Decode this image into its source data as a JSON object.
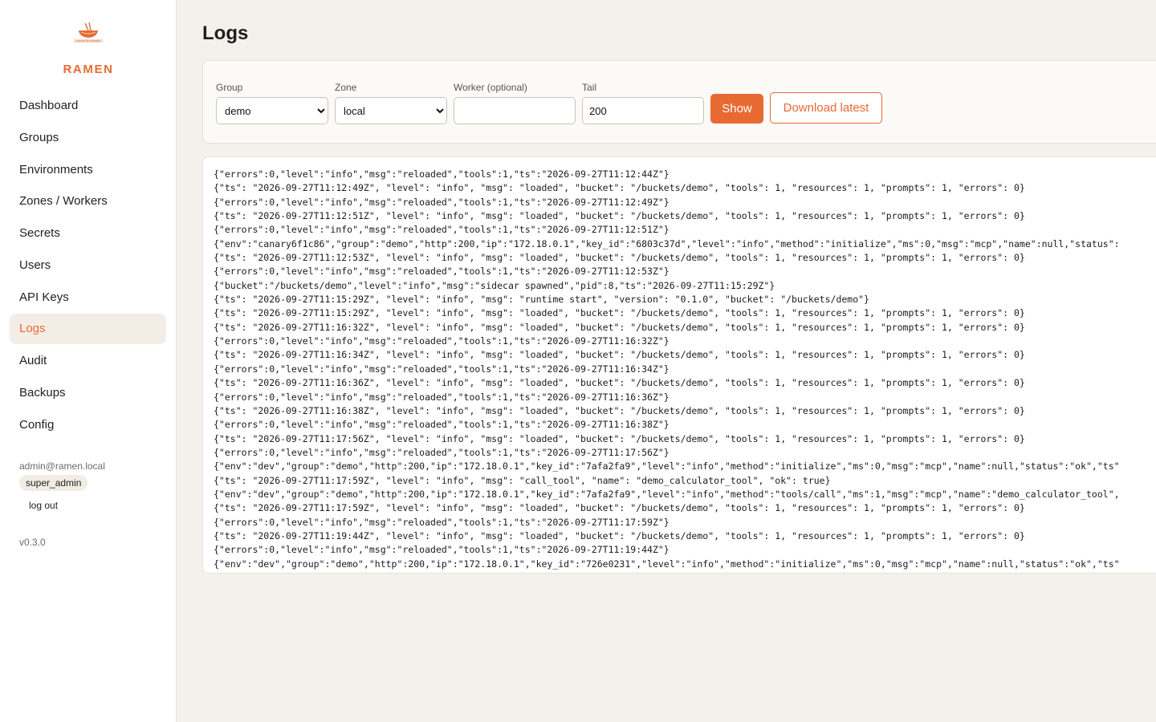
{
  "sidebar": {
    "brand": "RAMEN",
    "logo_text": "TASTE OF RAMEN",
    "items": [
      {
        "label": "Dashboard",
        "name": "sidebar-item-dashboard"
      },
      {
        "label": "Groups",
        "name": "sidebar-item-groups"
      },
      {
        "label": "Environments",
        "name": "sidebar-item-environments"
      },
      {
        "label": "Zones / Workers",
        "name": "sidebar-item-zones-workers"
      },
      {
        "label": "Secrets",
        "name": "sidebar-item-secrets"
      },
      {
        "label": "Users",
        "name": "sidebar-item-users"
      },
      {
        "label": "API Keys",
        "name": "sidebar-item-api-keys"
      },
      {
        "label": "Logs",
        "name": "sidebar-item-logs",
        "active": true
      },
      {
        "label": "Audit",
        "name": "sidebar-item-audit"
      },
      {
        "label": "Backups",
        "name": "sidebar-item-backups"
      },
      {
        "label": "Config",
        "name": "sidebar-item-config"
      }
    ],
    "user_email": "admin@ramen.local",
    "role": "super_admin",
    "logout_label": "log out",
    "version": "v0.3.0"
  },
  "page": {
    "title": "Logs"
  },
  "filters": {
    "group_label": "Group",
    "group_value": "demo",
    "zone_label": "Zone",
    "zone_value": "local",
    "worker_label": "Worker (optional)",
    "worker_value": "",
    "tail_label": "Tail",
    "tail_value": "200",
    "show_label": "Show",
    "download_label": "Download latest"
  },
  "colors": {
    "accent": "#e86a33",
    "active_bg": "#f3ede6",
    "page_bg": "#f4f1ec"
  },
  "logs": [
    "{\"errors\":0,\"level\":\"info\",\"msg\":\"reloaded\",\"tools\":1,\"ts\":\"2026-09-27T11:12:44Z\"}",
    "{\"ts\": \"2026-09-27T11:12:49Z\", \"level\": \"info\", \"msg\": \"loaded\", \"bucket\": \"/buckets/demo\", \"tools\": 1, \"resources\": 1, \"prompts\": 1, \"errors\": 0}",
    "{\"errors\":0,\"level\":\"info\",\"msg\":\"reloaded\",\"tools\":1,\"ts\":\"2026-09-27T11:12:49Z\"}",
    "{\"ts\": \"2026-09-27T11:12:51Z\", \"level\": \"info\", \"msg\": \"loaded\", \"bucket\": \"/buckets/demo\", \"tools\": 1, \"resources\": 1, \"prompts\": 1, \"errors\": 0}",
    "{\"errors\":0,\"level\":\"info\",\"msg\":\"reloaded\",\"tools\":1,\"ts\":\"2026-09-27T11:12:51Z\"}",
    "{\"env\":\"canary6f1c86\",\"group\":\"demo\",\"http\":200,\"ip\":\"172.18.0.1\",\"key_id\":\"6803c37d\",\"level\":\"info\",\"method\":\"initialize\",\"ms\":0,\"msg\":\"mcp\",\"name\":null,\"status\":",
    "{\"ts\": \"2026-09-27T11:12:53Z\", \"level\": \"info\", \"msg\": \"loaded\", \"bucket\": \"/buckets/demo\", \"tools\": 1, \"resources\": 1, \"prompts\": 1, \"errors\": 0}",
    "{\"errors\":0,\"level\":\"info\",\"msg\":\"reloaded\",\"tools\":1,\"ts\":\"2026-09-27T11:12:53Z\"}",
    "{\"bucket\":\"/buckets/demo\",\"level\":\"info\",\"msg\":\"sidecar spawned\",\"pid\":8,\"ts\":\"2026-09-27T11:15:29Z\"}",
    "{\"ts\": \"2026-09-27T11:15:29Z\", \"level\": \"info\", \"msg\": \"runtime start\", \"version\": \"0.1.0\", \"bucket\": \"/buckets/demo\"}",
    "{\"ts\": \"2026-09-27T11:15:29Z\", \"level\": \"info\", \"msg\": \"loaded\", \"bucket\": \"/buckets/demo\", \"tools\": 1, \"resources\": 1, \"prompts\": 1, \"errors\": 0}",
    "{\"ts\": \"2026-09-27T11:16:32Z\", \"level\": \"info\", \"msg\": \"loaded\", \"bucket\": \"/buckets/demo\", \"tools\": 1, \"resources\": 1, \"prompts\": 1, \"errors\": 0}",
    "{\"errors\":0,\"level\":\"info\",\"msg\":\"reloaded\",\"tools\":1,\"ts\":\"2026-09-27T11:16:32Z\"}",
    "{\"ts\": \"2026-09-27T11:16:34Z\", \"level\": \"info\", \"msg\": \"loaded\", \"bucket\": \"/buckets/demo\", \"tools\": 1, \"resources\": 1, \"prompts\": 1, \"errors\": 0}",
    "{\"errors\":0,\"level\":\"info\",\"msg\":\"reloaded\",\"tools\":1,\"ts\":\"2026-09-27T11:16:34Z\"}",
    "{\"ts\": \"2026-09-27T11:16:36Z\", \"level\": \"info\", \"msg\": \"loaded\", \"bucket\": \"/buckets/demo\", \"tools\": 1, \"resources\": 1, \"prompts\": 1, \"errors\": 0}",
    "{\"errors\":0,\"level\":\"info\",\"msg\":\"reloaded\",\"tools\":1,\"ts\":\"2026-09-27T11:16:36Z\"}",
    "{\"ts\": \"2026-09-27T11:16:38Z\", \"level\": \"info\", \"msg\": \"loaded\", \"bucket\": \"/buckets/demo\", \"tools\": 1, \"resources\": 1, \"prompts\": 1, \"errors\": 0}",
    "{\"errors\":0,\"level\":\"info\",\"msg\":\"reloaded\",\"tools\":1,\"ts\":\"2026-09-27T11:16:38Z\"}",
    "{\"ts\": \"2026-09-27T11:17:56Z\", \"level\": \"info\", \"msg\": \"loaded\", \"bucket\": \"/buckets/demo\", \"tools\": 1, \"resources\": 1, \"prompts\": 1, \"errors\": 0}",
    "{\"errors\":0,\"level\":\"info\",\"msg\":\"reloaded\",\"tools\":1,\"ts\":\"2026-09-27T11:17:56Z\"}",
    "{\"env\":\"dev\",\"group\":\"demo\",\"http\":200,\"ip\":\"172.18.0.1\",\"key_id\":\"7afa2fa9\",\"level\":\"info\",\"method\":\"initialize\",\"ms\":0,\"msg\":\"mcp\",\"name\":null,\"status\":\"ok\",\"ts\"",
    "{\"ts\": \"2026-09-27T11:17:59Z\", \"level\": \"info\", \"msg\": \"call_tool\", \"name\": \"demo_calculator_tool\", \"ok\": true}",
    "{\"env\":\"dev\",\"group\":\"demo\",\"http\":200,\"ip\":\"172.18.0.1\",\"key_id\":\"7afa2fa9\",\"level\":\"info\",\"method\":\"tools/call\",\"ms\":1,\"msg\":\"mcp\",\"name\":\"demo_calculator_tool\",",
    "{\"ts\": \"2026-09-27T11:17:59Z\", \"level\": \"info\", \"msg\": \"loaded\", \"bucket\": \"/buckets/demo\", \"tools\": 1, \"resources\": 1, \"prompts\": 1, \"errors\": 0}",
    "{\"errors\":0,\"level\":\"info\",\"msg\":\"reloaded\",\"tools\":1,\"ts\":\"2026-09-27T11:17:59Z\"}",
    "{\"ts\": \"2026-09-27T11:19:44Z\", \"level\": \"info\", \"msg\": \"loaded\", \"bucket\": \"/buckets/demo\", \"tools\": 1, \"resources\": 1, \"prompts\": 1, \"errors\": 0}",
    "{\"errors\":0,\"level\":\"info\",\"msg\":\"reloaded\",\"tools\":1,\"ts\":\"2026-09-27T11:19:44Z\"}",
    "{\"env\":\"dev\",\"group\":\"demo\",\"http\":200,\"ip\":\"172.18.0.1\",\"key_id\":\"726e0231\",\"level\":\"info\",\"method\":\"initialize\",\"ms\":0,\"msg\":\"mcp\",\"name\":null,\"status\":\"ok\",\"ts\""
  ]
}
